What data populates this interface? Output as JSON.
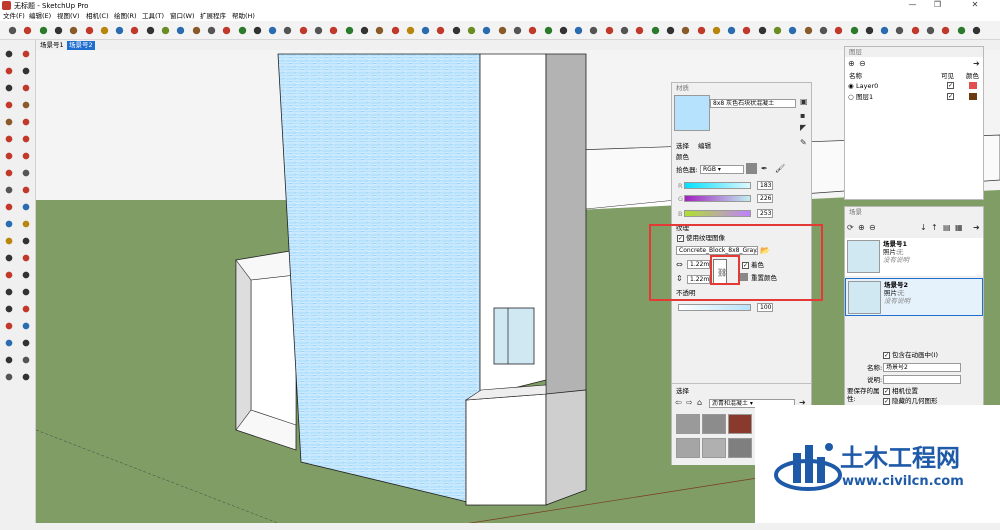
{
  "app": {
    "title": "无标题 - SketchUp Pro"
  },
  "menu": [
    "文件(F)",
    "编辑(E)",
    "视图(V)",
    "相机(C)",
    "绘图(R)",
    "工具(T)",
    "窗口(W)",
    "扩展程序",
    "帮助(H)"
  ],
  "scenes_tabs": [
    "场景号1",
    "场景号2"
  ],
  "materials_panel": {
    "title": "材质",
    "material_name": "8x8 灰色石块状混凝土",
    "tab_select": "选择",
    "tab_edit": "编辑",
    "color_label": "颜色",
    "picker_label": "拾色器:",
    "picker_value": "RGB",
    "r_label": "R",
    "r_value": "183",
    "g_label": "G",
    "g_value": "226",
    "b_label": "B",
    "b_value": "253",
    "texture_label": "纹理",
    "use_texture_label": "使用纹理图像",
    "texture_file": "Concrete_Block_8x8_Gray.jpg",
    "width_value": "1.22m",
    "height_value": "1.22m",
    "colorize_label": "着色",
    "reset_color_label": "重置颜色",
    "opacity_label": "不透明",
    "opacity_value": "100",
    "select_label": "选择",
    "library_value": "沥青和混凝土"
  },
  "layers_panel": {
    "title": "图层",
    "col_name": "名称",
    "col_visible": "可见",
    "col_color": "颜色",
    "rows": [
      {
        "name": "Layer0",
        "color": "#e05050"
      },
      {
        "name": "图层1",
        "color": "#6b3a10"
      }
    ]
  },
  "scenes_panel": {
    "title": "场景",
    "items": [
      {
        "name": "场景号1",
        "photo_label": "照片:",
        "photo_value": "无",
        "desc": "没有说明"
      },
      {
        "name": "场景号2",
        "photo_label": "照片:",
        "photo_value": "无",
        "desc": "没有说明"
      }
    ],
    "include_anim": "包含在动画中(I)",
    "name_label": "名称:",
    "name_value": "场景号2",
    "desc_label": "说明:",
    "save_props_label": "要保存的属性:",
    "camera_pos": "相机位置",
    "hidden_geo": "隐藏的几何图形"
  },
  "watermark": {
    "brand": "土木工程网",
    "url": "www.civilcn.com"
  },
  "colors": {
    "sky": "#f4f4f4",
    "ground": "#7f9d64",
    "accent": "#1f6fd0",
    "highlight": "#e53935"
  }
}
